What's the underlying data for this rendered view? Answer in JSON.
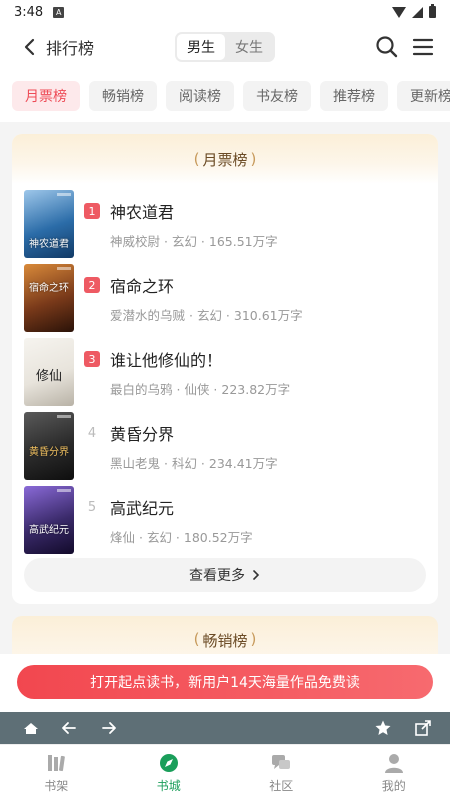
{
  "status": {
    "time": "3:48",
    "indicator": "A"
  },
  "header": {
    "title": "排行榜",
    "gender_options": [
      "男生",
      "女生"
    ],
    "gender_active": "男生"
  },
  "tabs": [
    "月票榜",
    "畅销榜",
    "阅读榜",
    "书友榜",
    "推荐榜",
    "更新榜"
  ],
  "active_tab": "月票榜",
  "ranking": {
    "title": "月票榜",
    "books": [
      {
        "rank": "1",
        "title": "神农道君",
        "author": "神威校尉",
        "genre": "玄幻",
        "words": "165.51万字",
        "cover_text": "神农道君",
        "cover_color": "#2b6ca8"
      },
      {
        "rank": "2",
        "title": "宿命之环",
        "author": "爱潜水的乌贼",
        "genre": "玄幻",
        "words": "310.61万字",
        "cover_text": "宿命之环",
        "cover_color": "#7a3a1a"
      },
      {
        "rank": "3",
        "title": "谁让他修仙的！",
        "author": "最白的乌鸦",
        "genre": "仙侠",
        "words": "223.82万字",
        "cover_text": "修仙",
        "cover_color": "#e8e4dc"
      },
      {
        "rank": "4",
        "title": "黄昏分界",
        "author": "黑山老鬼",
        "genre": "科幻",
        "words": "234.41万字",
        "cover_text": "黄昏分界",
        "cover_color": "#2a2a2a"
      },
      {
        "rank": "5",
        "title": "高武纪元",
        "author": "烽仙",
        "genre": "玄幻",
        "words": "180.52万字",
        "cover_text": "高武纪元",
        "cover_color": "#3a2a6a"
      }
    ],
    "more_label": "查看更多"
  },
  "next_section_title": "畅销榜",
  "promo_text": "打开起点读书，新用户14天海量作品免费读",
  "bottom_nav": [
    "书架",
    "书城",
    "社区",
    "我的"
  ],
  "bottom_nav_active": "书城",
  "colors": {
    "accent_red": "#ee4b56",
    "nav_green": "#1a9e5a",
    "browser_bar": "#5e6f76"
  }
}
